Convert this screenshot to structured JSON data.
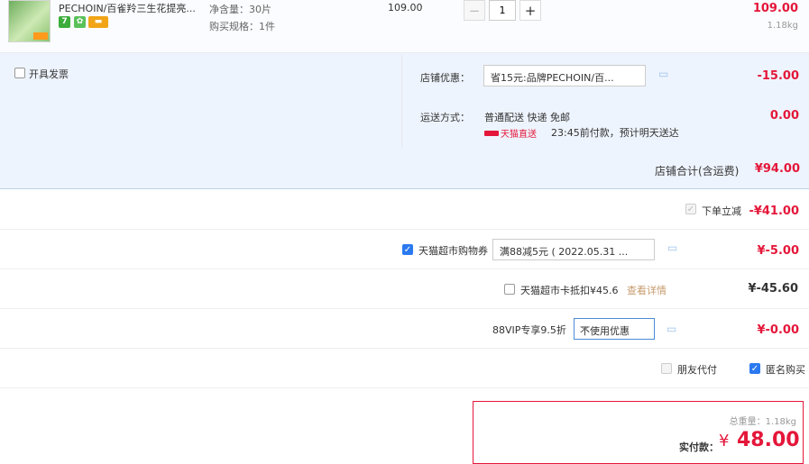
{
  "product": {
    "title": "PECHOIN/百雀羚三生花提亮...",
    "service_icons": [
      "seven-day-return-icon",
      "gold-medal-icon",
      "card-pay-icon"
    ],
    "spec_net": "净含量：30片",
    "spec_buy": "购买规格：1件",
    "unit_price": "109.00",
    "quantity": "1",
    "qty_minus": "−",
    "qty_plus": "+",
    "row_total": "109.00",
    "row_weight": "1.18kg"
  },
  "invoice": {
    "label": "开具发票"
  },
  "shop_discount": {
    "label": "店铺优惠：",
    "selected": "省15元:品牌PECHOIN/百...",
    "amount": "-15.00"
  },
  "shipping": {
    "label": "运送方式：",
    "text": "普通配送 快递 免邮",
    "tag": "天猫直送",
    "eta": "23:45前付款，预计明天送达",
    "amount": "0.00"
  },
  "shop_total": {
    "label": "店铺合计(含运费)",
    "amount": "¥94.00"
  },
  "instant_discount": {
    "label": "下单立减",
    "amount": "-¥41.00"
  },
  "coupon": {
    "label": "天猫超市购物券",
    "selected": "满88减5元 ( 2022.05.31 ...",
    "amount": "¥-5.00"
  },
  "card_deduct": {
    "label": "天猫超市卡抵扣¥45.6",
    "link": "查看详情",
    "amount": "¥-45.60"
  },
  "vip": {
    "label": "88VIP专享9.5折",
    "selected": "不使用优惠",
    "amount": "¥-0.00"
  },
  "options": {
    "friend_pay": "朋友代付",
    "anonymous": "匿名购买"
  },
  "summary": {
    "weight": "总重量：1.18kg",
    "pay_label": "实付款：",
    "currency": "¥",
    "amount": "48.00"
  },
  "colors": {
    "price_red": "#e4173a",
    "accent_blue": "#2b79f0",
    "section_bg": "#eef4fd",
    "link_tan": "#c69b6d"
  }
}
